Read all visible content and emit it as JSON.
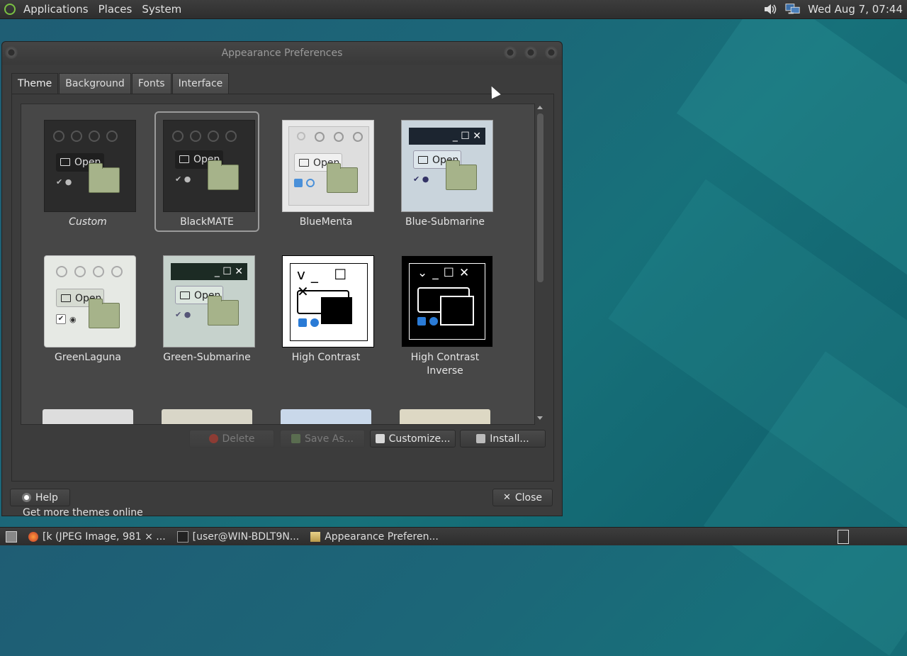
{
  "top_panel": {
    "menus": [
      "Applications",
      "Places",
      "System"
    ],
    "clock": "Wed Aug 7, 07:44",
    "icons": [
      "mate-logo-icon",
      "volume-icon",
      "network-icon"
    ]
  },
  "window": {
    "title": "Appearance Preferences",
    "tabs": [
      "Theme",
      "Background",
      "Fonts",
      "Interface"
    ],
    "active_tab": "Theme",
    "themes": [
      {
        "name": "Custom"
      },
      {
        "name": "BlackMATE"
      },
      {
        "name": "BlueMenta"
      },
      {
        "name": "Blue-Submarine"
      },
      {
        "name": "GreenLaguna"
      },
      {
        "name": "Green-Submarine"
      },
      {
        "name": "High Contrast"
      },
      {
        "name": "High Contrast Inverse"
      }
    ],
    "selected_theme": "BlackMATE",
    "thumb_text": "Open",
    "buttons": {
      "delete": "Delete",
      "save_as": "Save As...",
      "customize": "Customize...",
      "install": "Install..."
    },
    "get_more": "Get more themes online",
    "help": "Help",
    "close": "Close"
  },
  "taskbar": {
    "items": [
      "[k (JPEG Image, 981 × ...",
      "[user@WIN-BDLT9N...",
      "Appearance Preferen..."
    ]
  },
  "colors": {
    "desktop": "#1c6678",
    "window_bg": "#3c3c3c",
    "list_bg": "#474747",
    "folder": "#a6b38a",
    "check_blue": "#2a7bd6"
  }
}
